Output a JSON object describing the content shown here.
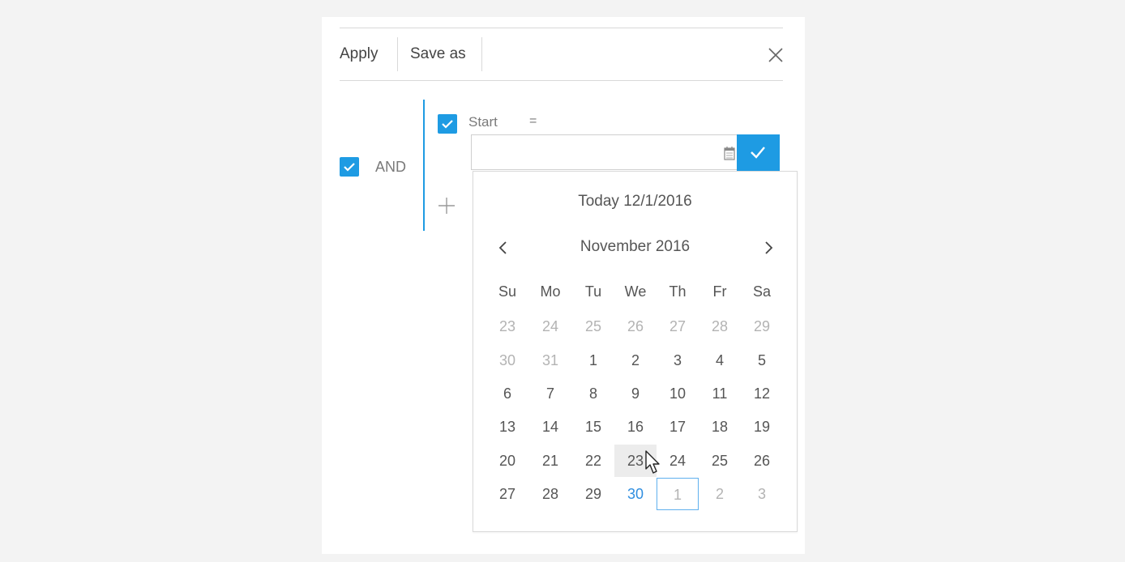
{
  "toolbar": {
    "apply_label": "Apply",
    "save_as_label": "Save as"
  },
  "filter": {
    "group_operator": "AND",
    "condition": {
      "field": "Start",
      "operator": "=",
      "value": ""
    }
  },
  "calendar": {
    "today_label": "Today 12/1/2016",
    "month_title": "November 2016",
    "weekdays": [
      "Su",
      "Mo",
      "Tu",
      "We",
      "Th",
      "Fr",
      "Sa"
    ],
    "weeks": [
      [
        "23",
        "24",
        "25",
        "26",
        "27",
        "28",
        "29"
      ],
      [
        "30",
        "31",
        "1",
        "2",
        "3",
        "4",
        "5"
      ],
      [
        "6",
        "7",
        "8",
        "9",
        "10",
        "11",
        "12"
      ],
      [
        "13",
        "14",
        "15",
        "16",
        "17",
        "18",
        "19"
      ],
      [
        "20",
        "21",
        "22",
        "23",
        "24",
        "25",
        "26"
      ],
      [
        "27",
        "28",
        "29",
        "30",
        "1",
        "2",
        "3"
      ]
    ]
  },
  "colors": {
    "accent": "#1e9be3",
    "selected_day": "#2f8ee0"
  }
}
